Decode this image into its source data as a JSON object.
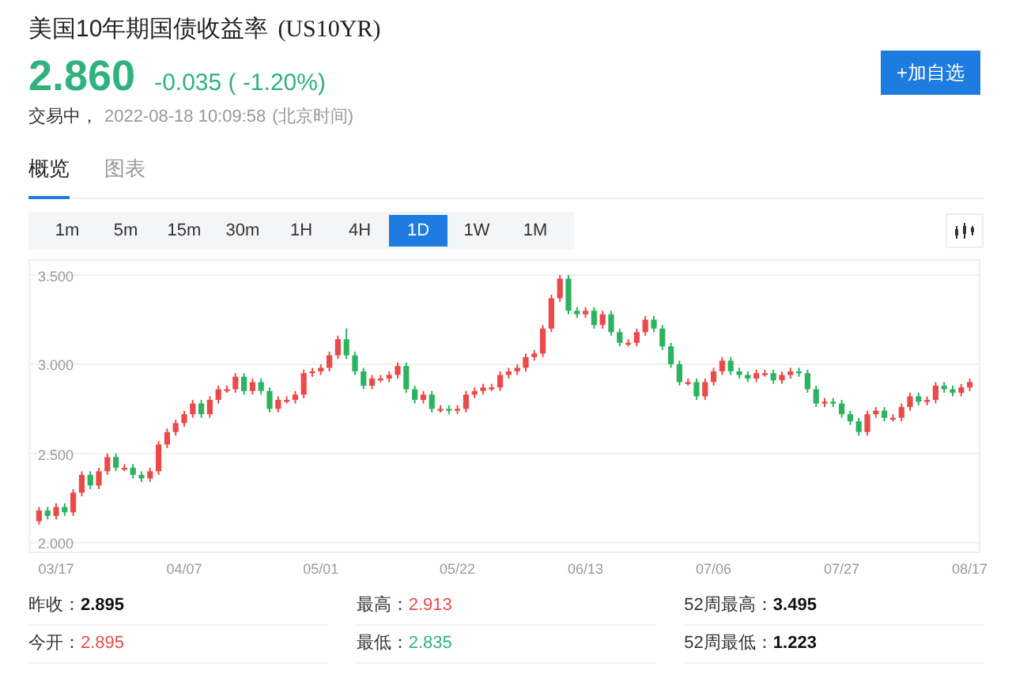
{
  "header": {
    "title": "美国10年期国债收益率",
    "symbol": "(US10YR)",
    "price": "2.860",
    "change": "-0.035 ( -1.20%)",
    "color": "#30b27f",
    "status": "交易中，",
    "time": "2022-08-18 10:09:58",
    "timezone": "(北京时间)",
    "add_button": "+加自选"
  },
  "tabs": [
    {
      "label": "概览",
      "selected": true
    },
    {
      "label": "图表",
      "selected": false
    }
  ],
  "intervals": [
    {
      "label": "1m",
      "selected": false
    },
    {
      "label": "5m",
      "selected": false
    },
    {
      "label": "15m",
      "selected": false
    },
    {
      "label": "30m",
      "selected": false
    },
    {
      "label": "1H",
      "selected": false
    },
    {
      "label": "4H",
      "selected": false
    },
    {
      "label": "1D",
      "selected": true
    },
    {
      "label": "1W",
      "selected": false
    },
    {
      "label": "1M",
      "selected": false
    }
  ],
  "chart": {
    "chart_data": {
      "type": "candlestick",
      "categories": [
        null,
        null,
        "03/17",
        null,
        null,
        null,
        null,
        null,
        null,
        null,
        null,
        null,
        null,
        null,
        null,
        null,
        null,
        "04/07",
        null,
        null,
        null,
        null,
        null,
        null,
        null,
        null,
        null,
        null,
        null,
        null,
        null,
        null,
        null,
        "05/01",
        null,
        null,
        null,
        null,
        null,
        null,
        null,
        null,
        null,
        null,
        null,
        null,
        null,
        null,
        null,
        "05/22",
        null,
        null,
        null,
        null,
        null,
        null,
        null,
        null,
        null,
        null,
        null,
        null,
        null,
        null,
        "06/13",
        null,
        null,
        null,
        null,
        null,
        null,
        null,
        null,
        null,
        null,
        null,
        null,
        null,
        null,
        "07/06",
        null,
        null,
        null,
        null,
        null,
        null,
        null,
        null,
        null,
        null,
        null,
        null,
        null,
        null,
        "07/27",
        null,
        null,
        null,
        null,
        null,
        null,
        null,
        null,
        null,
        null,
        null,
        null,
        null,
        null,
        "08/17"
      ],
      "ohlc": [
        [
          2.12,
          2.2,
          2.1,
          2.18
        ],
        [
          2.18,
          2.2,
          2.13,
          2.15
        ],
        [
          2.15,
          2.22,
          2.13,
          2.2
        ],
        [
          2.2,
          2.22,
          2.15,
          2.17
        ],
        [
          2.17,
          2.3,
          2.15,
          2.28
        ],
        [
          2.28,
          2.4,
          2.26,
          2.38
        ],
        [
          2.38,
          2.4,
          2.3,
          2.32
        ],
        [
          2.32,
          2.42,
          2.3,
          2.4
        ],
        [
          2.4,
          2.5,
          2.38,
          2.48
        ],
        [
          2.48,
          2.5,
          2.4,
          2.42
        ],
        [
          2.42,
          2.44,
          2.4,
          2.42
        ],
        [
          2.42,
          2.44,
          2.36,
          2.38
        ],
        [
          2.38,
          2.4,
          2.34,
          2.36
        ],
        [
          2.36,
          2.42,
          2.34,
          2.4
        ],
        [
          2.4,
          2.57,
          2.38,
          2.55
        ],
        [
          2.55,
          2.64,
          2.53,
          2.62
        ],
        [
          2.62,
          2.69,
          2.6,
          2.67
        ],
        [
          2.67,
          2.74,
          2.65,
          2.72
        ],
        [
          2.72,
          2.8,
          2.7,
          2.78
        ],
        [
          2.78,
          2.8,
          2.7,
          2.72
        ],
        [
          2.72,
          2.82,
          2.7,
          2.8
        ],
        [
          2.8,
          2.88,
          2.78,
          2.86
        ],
        [
          2.86,
          2.88,
          2.84,
          2.86
        ],
        [
          2.86,
          2.95,
          2.84,
          2.93
        ],
        [
          2.93,
          2.95,
          2.83,
          2.85
        ],
        [
          2.85,
          2.92,
          2.83,
          2.9
        ],
        [
          2.9,
          2.92,
          2.83,
          2.85
        ],
        [
          2.85,
          2.87,
          2.73,
          2.75
        ],
        [
          2.75,
          2.82,
          2.73,
          2.8
        ],
        [
          2.8,
          2.82,
          2.78,
          2.8
        ],
        [
          2.8,
          2.85,
          2.78,
          2.83
        ],
        [
          2.83,
          2.97,
          2.81,
          2.95
        ],
        [
          2.95,
          2.98,
          2.93,
          2.96
        ],
        [
          2.96,
          3.0,
          2.94,
          2.98
        ],
        [
          2.98,
          3.07,
          2.96,
          3.05
        ],
        [
          3.05,
          3.16,
          3.03,
          3.14
        ],
        [
          3.14,
          3.2,
          3.03,
          3.05
        ],
        [
          3.05,
          3.07,
          2.94,
          2.96
        ],
        [
          2.96,
          2.98,
          2.86,
          2.88
        ],
        [
          2.88,
          2.94,
          2.86,
          2.92
        ],
        [
          2.92,
          2.94,
          2.9,
          2.92
        ],
        [
          2.92,
          2.96,
          2.9,
          2.94
        ],
        [
          2.94,
          3.01,
          2.92,
          2.99
        ],
        [
          2.99,
          3.01,
          2.84,
          2.86
        ],
        [
          2.86,
          2.88,
          2.78,
          2.8
        ],
        [
          2.8,
          2.85,
          2.78,
          2.83
        ],
        [
          2.83,
          2.85,
          2.73,
          2.75
        ],
        [
          2.75,
          2.77,
          2.73,
          2.75
        ],
        [
          2.75,
          2.77,
          2.72,
          2.74
        ],
        [
          2.74,
          2.77,
          2.72,
          2.75
        ],
        [
          2.75,
          2.85,
          2.73,
          2.83
        ],
        [
          2.83,
          2.87,
          2.81,
          2.85
        ],
        [
          2.85,
          2.89,
          2.83,
          2.87
        ],
        [
          2.87,
          2.89,
          2.85,
          2.87
        ],
        [
          2.87,
          2.96,
          2.85,
          2.94
        ],
        [
          2.94,
          2.98,
          2.92,
          2.96
        ],
        [
          2.96,
          3.0,
          2.94,
          2.98
        ],
        [
          2.98,
          3.06,
          2.96,
          3.04
        ],
        [
          3.04,
          3.08,
          3.02,
          3.06
        ],
        [
          3.06,
          3.22,
          3.04,
          3.2
        ],
        [
          3.2,
          3.39,
          3.18,
          3.37
        ],
        [
          3.37,
          3.5,
          3.35,
          3.48
        ],
        [
          3.48,
          3.5,
          3.28,
          3.3
        ],
        [
          3.3,
          3.32,
          3.26,
          3.28
        ],
        [
          3.28,
          3.32,
          3.26,
          3.3
        ],
        [
          3.3,
          3.32,
          3.2,
          3.22
        ],
        [
          3.22,
          3.3,
          3.2,
          3.28
        ],
        [
          3.28,
          3.3,
          3.16,
          3.18
        ],
        [
          3.18,
          3.2,
          3.1,
          3.12
        ],
        [
          3.12,
          3.14,
          3.1,
          3.12
        ],
        [
          3.12,
          3.2,
          3.1,
          3.18
        ],
        [
          3.18,
          3.27,
          3.16,
          3.25
        ],
        [
          3.25,
          3.27,
          3.18,
          3.2
        ],
        [
          3.2,
          3.22,
          3.08,
          3.1
        ],
        [
          3.1,
          3.12,
          2.98,
          3.0
        ],
        [
          3.0,
          3.02,
          2.88,
          2.9
        ],
        [
          2.9,
          2.92,
          2.88,
          2.9
        ],
        [
          2.9,
          2.92,
          2.8,
          2.82
        ],
        [
          2.82,
          2.92,
          2.8,
          2.9
        ],
        [
          2.9,
          2.98,
          2.88,
          2.96
        ],
        [
          2.96,
          3.04,
          2.94,
          3.02
        ],
        [
          3.02,
          3.04,
          2.94,
          2.96
        ],
        [
          2.96,
          2.98,
          2.92,
          2.94
        ],
        [
          2.94,
          2.96,
          2.9,
          2.92
        ],
        [
          2.92,
          2.97,
          2.9,
          2.95
        ],
        [
          2.95,
          2.97,
          2.93,
          2.95
        ],
        [
          2.95,
          2.97,
          2.89,
          2.91
        ],
        [
          2.91,
          2.96,
          2.89,
          2.94
        ],
        [
          2.94,
          2.98,
          2.92,
          2.96
        ],
        [
          2.96,
          2.98,
          2.93,
          2.95
        ],
        [
          2.95,
          2.97,
          2.84,
          2.86
        ],
        [
          2.86,
          2.88,
          2.76,
          2.78
        ],
        [
          2.78,
          2.81,
          2.76,
          2.79
        ],
        [
          2.79,
          2.81,
          2.76,
          2.78
        ],
        [
          2.78,
          2.8,
          2.7,
          2.72
        ],
        [
          2.72,
          2.74,
          2.66,
          2.68
        ],
        [
          2.68,
          2.7,
          2.6,
          2.62
        ],
        [
          2.62,
          2.74,
          2.6,
          2.72
        ],
        [
          2.72,
          2.76,
          2.7,
          2.74
        ],
        [
          2.74,
          2.76,
          2.68,
          2.7
        ],
        [
          2.7,
          2.72,
          2.68,
          2.7
        ],
        [
          2.7,
          2.78,
          2.68,
          2.76
        ],
        [
          2.76,
          2.84,
          2.74,
          2.82
        ],
        [
          2.82,
          2.84,
          2.77,
          2.79
        ],
        [
          2.79,
          2.82,
          2.77,
          2.8
        ],
        [
          2.8,
          2.9,
          2.78,
          2.88
        ],
        [
          2.88,
          2.9,
          2.84,
          2.86
        ],
        [
          2.86,
          2.88,
          2.82,
          2.84
        ],
        [
          2.84,
          2.89,
          2.82,
          2.87
        ],
        [
          2.87,
          2.92,
          2.85,
          2.9
        ]
      ],
      "ylim": [
        1.95,
        3.58
      ],
      "grid": true,
      "yticks": [
        {
          "value": 3.5,
          "label": "3.500"
        },
        {
          "value": 3.0,
          "label": "3.000"
        },
        {
          "value": 2.5,
          "label": "2.500"
        },
        {
          "value": 2.0,
          "label": "2.000"
        }
      ]
    }
  },
  "stats": [
    {
      "label": "昨收：",
      "value": "2.895",
      "color": "#111111",
      "bold": true
    },
    {
      "label": "最高：",
      "value": "2.913",
      "color": "#e94a4a",
      "bold": false
    },
    {
      "label": "52周最高：",
      "value": "3.495",
      "color": "#111111",
      "bold": true
    },
    {
      "label": "今开：",
      "value": "2.895",
      "color": "#e94a4a",
      "bold": false
    },
    {
      "label": "最低：",
      "value": "2.835",
      "color": "#30b27f",
      "bold": false
    },
    {
      "label": "52周最低：",
      "value": "1.223",
      "color": "#111111",
      "bold": true
    }
  ]
}
